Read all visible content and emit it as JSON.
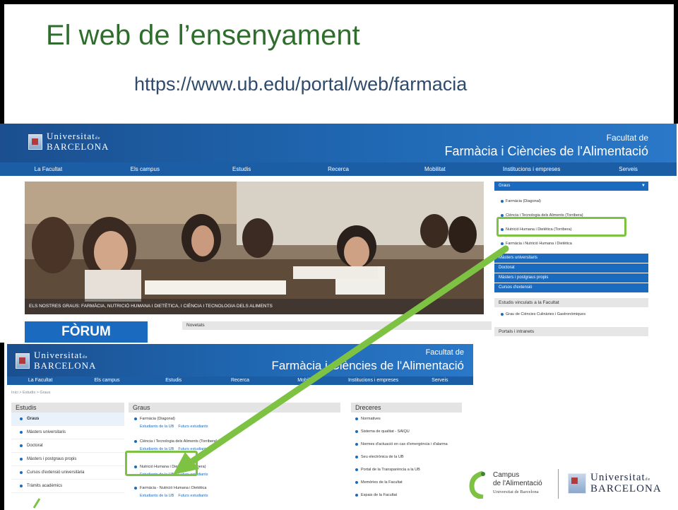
{
  "slide": {
    "title": "El web de l’ensenyament",
    "url": "https://www.ub.edu/portal/web/farmacia"
  },
  "colors": {
    "accent_green": "#7dc242",
    "ub_blue": "#1a6bc0",
    "title_green": "#2f6d2c"
  },
  "ub_logo": {
    "line1": "Universitat",
    "de": "de",
    "line2": "BARCELONA"
  },
  "shot1": {
    "faculty_line1": "Facultat de",
    "faculty_line2": "Farmàcia i Ciències de l'Alimentació",
    "nav": [
      "La Facultat",
      "Els campus",
      "Estudis",
      "Recerca",
      "Mobilitat",
      "Institucions i empreses",
      "Serveis"
    ],
    "hero_caption": "ELS NOSTRES GRAUS: FARMÀCIA, NUTRICIÓ HUMANA I DIETÈTICA, I CIÈNCIA I TECNOLOGIA DELS ALIMENTS",
    "graus_header": "Graus",
    "graus": [
      "Farmàcia (Diagonal)",
      "Ciència i Tecnologia dels Aliments (Torribera)",
      "Nutrició Humana i Dietètica (Torribera)",
      "Farmàcia i Nutrició Humana i Dietètica"
    ],
    "bars": [
      "Màsters universitaris",
      "Doctorat",
      "Màsters i postgraus propis",
      "Cursos d'extensió"
    ],
    "linked_header": "Estudis vinculats a la Facultat",
    "linked_item": "Grau de Ciències Culinàries i Gastronòmiques",
    "portals_header": "Portals i intranets",
    "forum": "FÒRUM",
    "novetats": "Novetats"
  },
  "shot2": {
    "faculty_line1": "Facultat de",
    "faculty_line2": "Farmàcia i Ciències de l'Alimentació",
    "nav": [
      "La Facultat",
      "Els campus",
      "Estudis",
      "Recerca",
      "Mobilitat",
      "Institucions i empreses",
      "Serveis"
    ],
    "breadcrumb": "Inici > Estudis > Graus",
    "estudis_header": "Estudis",
    "estudis": [
      "Graus",
      "Màsters universitaris",
      "Doctorat",
      "Màsters i postgraus propis",
      "Cursos d'extensió universitària",
      "Tràmits acadèmics"
    ],
    "graus_header": "Graus",
    "graus": [
      {
        "name": "Farmàcia (Diagonal)",
        "link1": "Estudiants de la UB",
        "link2": "Futurs estudiants"
      },
      {
        "name": "Ciència i Tecnologia dels Aliments (Torribera)",
        "link1": "Estudiants de la UB",
        "link2": "Futurs estudiants"
      },
      {
        "name": "Nutrició Humana i Dietètica (Torribera)",
        "link1": "Estudiants de la UB",
        "link2": "Futurs estudiants"
      },
      {
        "name": "Farmàcia - Nutrició Humana i Dietètica",
        "link1": "Estudiants de la UB",
        "link2": "Futurs estudiants"
      }
    ],
    "dreceres_header": "Dreceres",
    "dreceres": [
      "Normatives",
      "Sistema de qualitat - SAIQU",
      "Normes d'actuació en cas d'emergència i d'alarma",
      "Seu electrònica de la UB",
      "Portal de la Transparència a la UB",
      "Memòries de la Facultat",
      "Espais de la Facultat"
    ]
  },
  "footer_logos": {
    "campus_line1": "Campus",
    "campus_line2": "de l'Alimentació",
    "campus_line3": "Universitat de Barcelona",
    "ub_line1": "Universitat",
    "ub_de": "de",
    "ub_line2": "BARCELONA"
  }
}
